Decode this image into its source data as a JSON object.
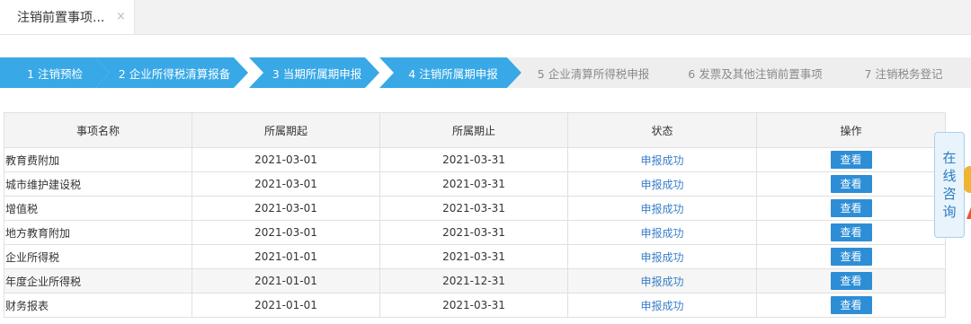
{
  "tab": {
    "title": "注销前置事项...",
    "close": "×"
  },
  "steps": [
    {
      "label": "1  注销预检",
      "state": "active"
    },
    {
      "label": "2  企业所得税清算报备",
      "state": "active"
    },
    {
      "label": "3  当期所属期申报",
      "state": "active"
    },
    {
      "label": "4  注销所属期申报",
      "state": "active"
    },
    {
      "label": "5  企业清算所得税申报",
      "state": "inactive"
    },
    {
      "label": "6  发票及其他注销前置事项",
      "state": "inactive"
    },
    {
      "label": "7  注销税务登记",
      "state": "inactive"
    }
  ],
  "table": {
    "headers": [
      "事项名称",
      "所属期起",
      "所属期止",
      "状态",
      "操作"
    ],
    "rows": [
      {
        "name": "教育费附加",
        "start": "2021-03-01",
        "end": "2021-03-31",
        "status": "申报成功",
        "action": "查看"
      },
      {
        "name": "城市维护建设税",
        "start": "2021-03-01",
        "end": "2021-03-31",
        "status": "申报成功",
        "action": "查看"
      },
      {
        "name": "增值税",
        "start": "2021-03-01",
        "end": "2021-03-31",
        "status": "申报成功",
        "action": "查看"
      },
      {
        "name": "地方教育附加",
        "start": "2021-03-01",
        "end": "2021-03-31",
        "status": "申报成功",
        "action": "查看"
      },
      {
        "name": "企业所得税",
        "start": "2021-01-01",
        "end": "2021-03-31",
        "status": "申报成功",
        "action": "查看"
      },
      {
        "name": "年度企业所得税",
        "start": "2021-01-01",
        "end": "2021-12-31",
        "status": "申报成功",
        "action": "查看"
      },
      {
        "name": "财务报表",
        "start": "2021-01-01",
        "end": "2021-03-31",
        "status": "申报成功",
        "action": "查看"
      }
    ]
  },
  "consult": {
    "chars": [
      "在",
      "线",
      "咨",
      "询"
    ]
  },
  "colors": {
    "step_active": "#38a8e6",
    "step_inactive": "#eeeeee",
    "button": "#2d8ed6",
    "status_link": "#3a7fc8"
  }
}
